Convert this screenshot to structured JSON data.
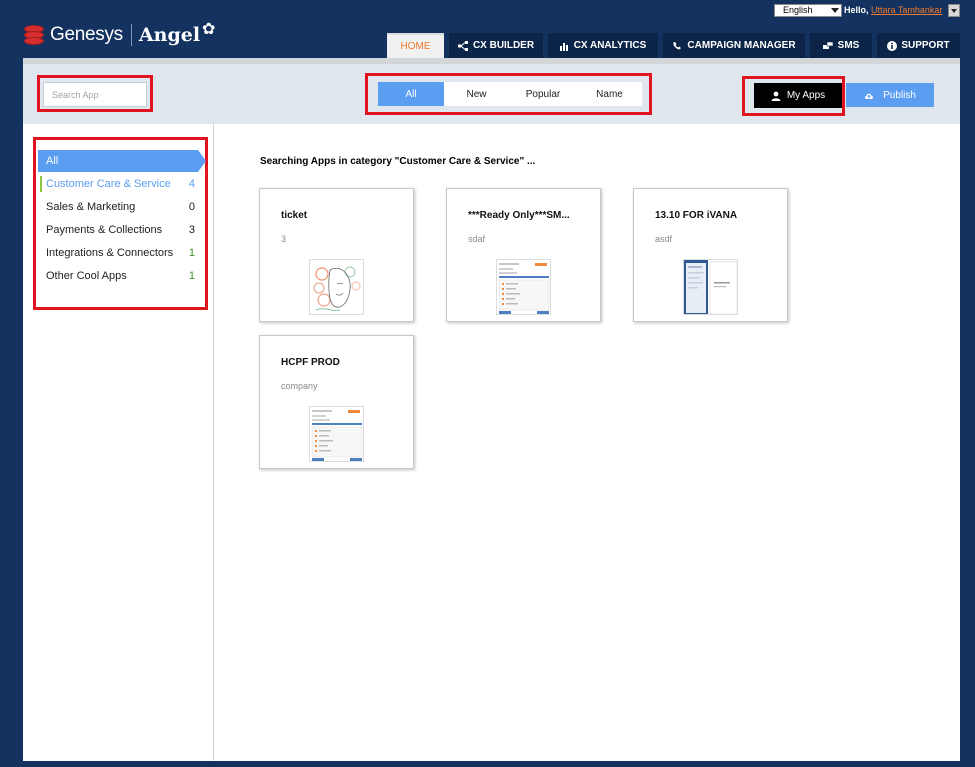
{
  "header": {
    "logo_brand": "Genesys",
    "logo_product": "Angel",
    "language": "English",
    "greeting": "Hello,",
    "username": "Uttara Tamhankar"
  },
  "nav": {
    "tabs": [
      {
        "label": "HOME",
        "icon": "none",
        "active": true
      },
      {
        "label": "CX BUILDER",
        "icon": "flow-icon"
      },
      {
        "label": "CX ANALYTICS",
        "icon": "bar-chart-icon"
      },
      {
        "label": "CAMPAIGN MANAGER",
        "icon": "phone-icon"
      },
      {
        "label": "SMS",
        "icon": "chat-icon"
      },
      {
        "label": "SUPPORT",
        "icon": "info-icon"
      }
    ]
  },
  "toolbar": {
    "search_placeholder": "Search App",
    "filters": [
      {
        "label": "All",
        "active": true
      },
      {
        "label": "New"
      },
      {
        "label": "Popular"
      },
      {
        "label": "Name"
      }
    ],
    "my_apps_label": "My Apps",
    "publish_label": "Publish"
  },
  "sidebar": {
    "all_label": "All",
    "categories": [
      {
        "label": "Customer Care & Service",
        "count": "4",
        "selected": true
      },
      {
        "label": "Sales & Marketing",
        "count": "0"
      },
      {
        "label": "Payments & Collections",
        "count": "3"
      },
      {
        "label": "Integrations & Connectors",
        "count": "1"
      },
      {
        "label": "Other Cool Apps",
        "count": "1"
      }
    ]
  },
  "results": {
    "heading": "Searching Apps in category \"Customer Care & Service\" ...",
    "apps": [
      {
        "title": "ticket",
        "subtitle": "3",
        "thumbnail": "floral-face-sketch"
      },
      {
        "title": "***Ready Only***SM...",
        "subtitle": "sdaf",
        "thumbnail": "app-form-screenshot"
      },
      {
        "title": "13.10 FOR iVANA",
        "subtitle": "asdf",
        "thumbnail": "app-dialog-screenshot"
      },
      {
        "title": "HCPF PROD",
        "subtitle": "company",
        "thumbnail": "app-form-screenshot"
      }
    ]
  },
  "colors": {
    "header_bg": "#13325f",
    "accent_blue": "#5b9df0",
    "brand_orange": "#f07a2c",
    "highlight_red": "#e0141e",
    "toolbar_bg": "#dfe6ed"
  }
}
